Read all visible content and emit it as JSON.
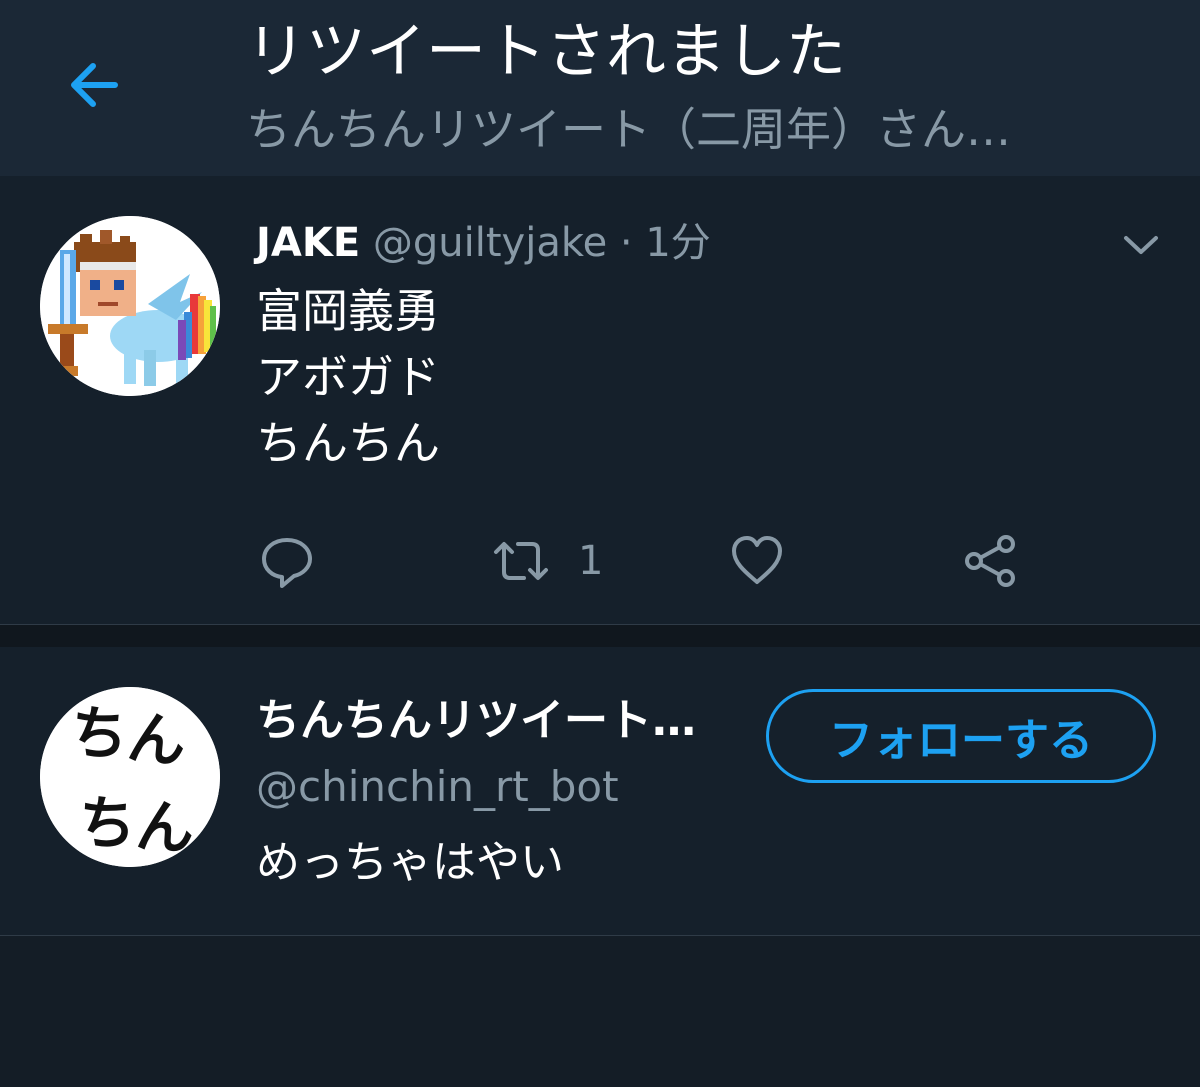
{
  "header": {
    "title": "リツイートされました",
    "subtitle": "ちんちんリツイート（二周年）さん…",
    "back_icon": "back-arrow-icon"
  },
  "tweet": {
    "display_name": "JAKE",
    "handle": "@guiltyjake",
    "separator": "·",
    "time": "1分",
    "lines": [
      "富岡義勇",
      "アボガド",
      "ちんちん"
    ],
    "actions": {
      "reply_icon": "reply-icon",
      "retweet_icon": "retweet-icon",
      "retweet_count": "1",
      "like_icon": "heart-icon",
      "share_icon": "share-icon"
    }
  },
  "retweeter": {
    "display_name": "ちんちんリツイート…",
    "handle": "@chinchin_rt_bot",
    "bio": "めっちゃはやい",
    "follow_label": "フォローする",
    "avatar_text": [
      "ちん",
      "ちん"
    ]
  },
  "colors": {
    "background": "#141d26",
    "header": "#1b2836",
    "accent": "#1da1f2",
    "secondary_text": "#8899a6"
  }
}
